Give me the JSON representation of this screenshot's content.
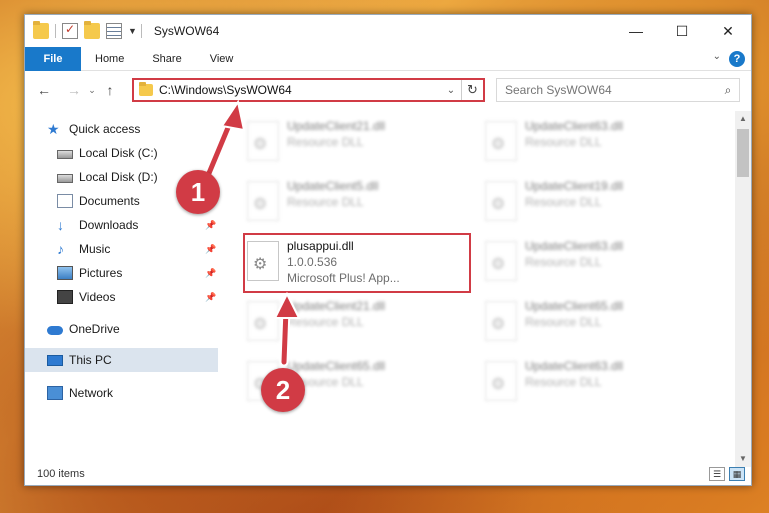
{
  "window": {
    "title": "SysWOW64",
    "caption_buttons": {
      "minimize": "—",
      "maximize": "☐",
      "close": "✕"
    }
  },
  "ribbon": {
    "tabs": [
      "File",
      "Home",
      "Share",
      "View"
    ],
    "help": "?"
  },
  "nav": {
    "back": "←",
    "forward": "→",
    "recent": "⌄",
    "up": "↑",
    "address_path": "C:\\Windows\\SysWOW64",
    "refresh": "↻",
    "search_placeholder": "Search SysWOW64"
  },
  "nav_pane": {
    "items": [
      {
        "label": "Quick access",
        "icon": "star-icon"
      },
      {
        "label": "Local Disk (C:)",
        "icon": "drive-icon"
      },
      {
        "label": "Local Disk (D:)",
        "icon": "drive-icon"
      },
      {
        "label": "Documents",
        "icon": "documents-icon"
      },
      {
        "label": "Downloads",
        "icon": "download-icon"
      },
      {
        "label": "Music",
        "icon": "music-icon"
      },
      {
        "label": "Pictures",
        "icon": "pictures-icon"
      },
      {
        "label": "Videos",
        "icon": "videos-icon"
      },
      {
        "label": "OneDrive",
        "icon": "onedrive-icon"
      },
      {
        "label": "This PC",
        "icon": "computer-icon"
      },
      {
        "label": "Network",
        "icon": "network-icon"
      }
    ],
    "selected": "This PC"
  },
  "files": {
    "left": [
      {
        "name": "UpdateClient21.dll",
        "sub1": "Resource DLL",
        "sub2": ""
      },
      {
        "name": "UpdateClient5.dll",
        "sub1": "Resource DLL",
        "sub2": ""
      },
      {
        "name": "plusappui.dll",
        "sub1": "1.0.0.536",
        "sub2": "Microsoft Plus! App..."
      },
      {
        "name": "UpdateClient21.dll",
        "sub1": "Resource DLL",
        "sub2": ""
      },
      {
        "name": "UpdateClient65.dll",
        "sub1": "Resource DLL",
        "sub2": ""
      }
    ],
    "right": [
      {
        "name": "UpdateClient63.dll",
        "sub1": "Resource DLL"
      },
      {
        "name": "UpdateClient19.dll",
        "sub1": "Resource DLL"
      },
      {
        "name": "UpdateClient63.dll",
        "sub1": "Resource DLL"
      },
      {
        "name": "UpdateClient65.dll",
        "sub1": "Resource DLL"
      },
      {
        "name": "UpdateClient63.dll",
        "sub1": "Resource DLL"
      }
    ]
  },
  "status": {
    "item_count": "100 items"
  },
  "annotations": {
    "step1": "1",
    "step2": "2",
    "color": "#d13b45"
  }
}
